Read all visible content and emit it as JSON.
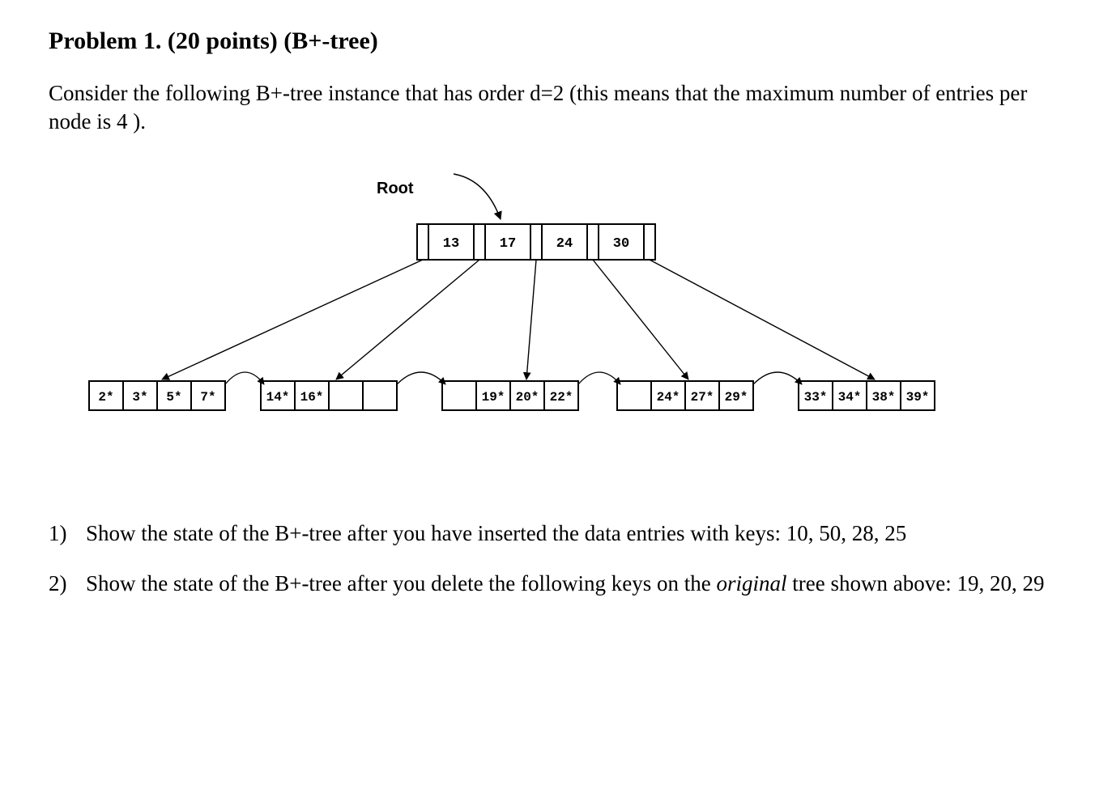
{
  "title": "Problem 1. (20 points) (B+-tree)",
  "intro": "Consider the following B+-tree instance that has order d=2 (this means that the maximum number of entries per node is 4 ).",
  "diagram": {
    "root_label": "Root",
    "root_keys": [
      "13",
      "17",
      "24",
      "30"
    ],
    "leaves": [
      {
        "cells": [
          "2*",
          "3*",
          "5*",
          "7*"
        ]
      },
      {
        "cells": [
          "14*",
          "16*",
          "",
          ""
        ]
      },
      {
        "cells": [
          "",
          "19*",
          "20*",
          "22*"
        ]
      },
      {
        "cells": [
          "",
          "24*",
          "27*",
          "29*"
        ]
      },
      {
        "cells": [
          "33*",
          "34*",
          "38*",
          "39*"
        ]
      }
    ]
  },
  "q1": {
    "num": "1)",
    "text": "Show the state of the B+-tree after you have inserted the data entries with keys: 10, 50, 28, 25"
  },
  "q2": {
    "num": "2)",
    "prefix": "Show the state of the B+-tree after you delete the following keys on the ",
    "italic": "original",
    "suffix": " tree shown above: 19, 20, 29"
  }
}
